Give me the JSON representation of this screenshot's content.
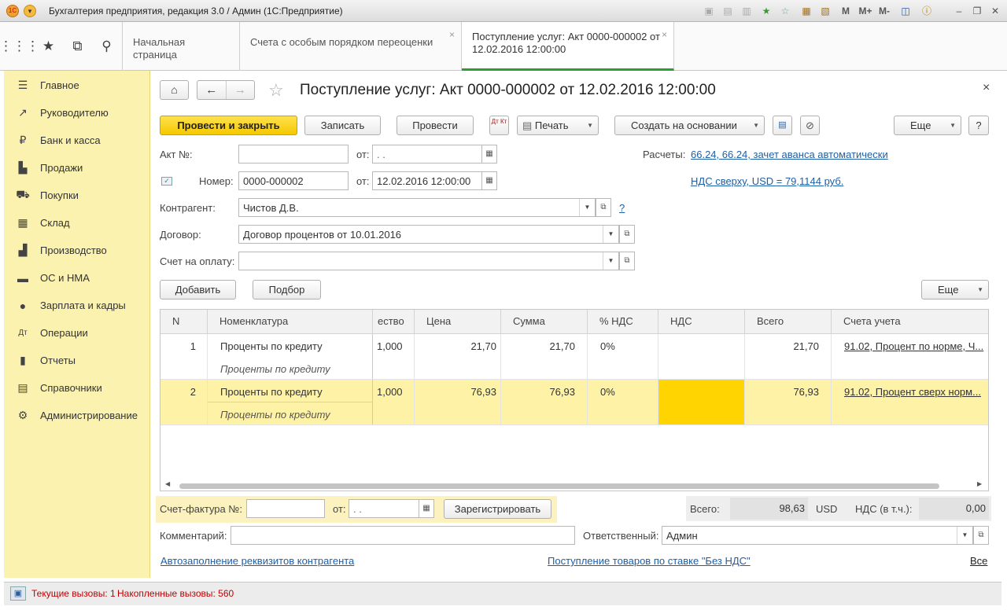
{
  "window": {
    "title": "Бухгалтерия предприятия, редакция 3.0 / Админ  (1С:Предприятие)",
    "tb_m": "M",
    "tb_mplus": "M+",
    "tb_mminus": "M-"
  },
  "tabs": [
    {
      "label": "Начальная страница"
    },
    {
      "label": "Счета с особым порядком переоценки",
      "close": "×"
    },
    {
      "label": "Поступление услуг: Акт 0000-000002 от 12.02.2016 12:00:00",
      "close": "×"
    }
  ],
  "sidebar": {
    "items": [
      {
        "label": "Главное",
        "icon": "menu-icon"
      },
      {
        "label": "Руководителю",
        "icon": "chart-line-icon"
      },
      {
        "label": "Банк и касса",
        "icon": "ruble-icon"
      },
      {
        "label": "Продажи",
        "icon": "bag-icon"
      },
      {
        "label": "Покупки",
        "icon": "cart-icon"
      },
      {
        "label": "Склад",
        "icon": "grid-icon"
      },
      {
        "label": "Производство",
        "icon": "factory-icon"
      },
      {
        "label": "ОС и НМА",
        "icon": "truck-icon"
      },
      {
        "label": "Зарплата и кадры",
        "icon": "person-icon"
      },
      {
        "label": "Операции",
        "icon": "dt-kt-icon"
      },
      {
        "label": "Отчеты",
        "icon": "bar-chart-icon"
      },
      {
        "label": "Справочники",
        "icon": "book-icon"
      },
      {
        "label": "Администрирование",
        "icon": "gear-icon"
      }
    ]
  },
  "form": {
    "title": "Поступление услуг: Акт 0000-000002 от 12.02.2016 12:00:00",
    "close": "×",
    "toolbar": {
      "post_close": "Провести и закрыть",
      "save": "Записать",
      "post": "Провести",
      "print": "Печать",
      "create_based": "Создать на основании",
      "more": "Еще",
      "help": "?",
      "dtkt": "Дт Кт"
    },
    "akt_label": "Акт №:",
    "akt_value": "",
    "from_label": "от:",
    "akt_date": " .  .",
    "number_label": "Номер:",
    "number_value": "0000-000002",
    "number_date": "12.02.2016 12:00:00",
    "raschety_label": "Расчеты:",
    "raschety_link": "66.24, 66.24, зачет аванса автоматически",
    "nds_link": "НДС сверху, USD = 79,1144 руб.",
    "kontragent_label": "Контрагент:",
    "kontragent_value": "Чистов Д.В.",
    "help_q": "?",
    "dogovor_label": "Договор:",
    "dogovor_value": "Договор процентов от 10.01.2016",
    "schet_label": "Счет на оплату:",
    "schet_value": "",
    "add_btn": "Добавить",
    "podbor_btn": "Подбор",
    "more_btn": "Еще"
  },
  "table": {
    "columns": [
      "N",
      "Номенклатура",
      "ество",
      "Цена",
      "Сумма",
      "% НДС",
      "НДС",
      "Всего",
      "Счета учета"
    ],
    "rows": [
      {
        "n": "1",
        "nom": "Проценты по кредиту",
        "nom2": "Проценты по кредиту",
        "qty": "1,000",
        "price": "21,70",
        "sum": "21,70",
        "vat_rate": "0%",
        "vat": "",
        "total": "21,70",
        "account": "91.02, Процент по норме, Ч..."
      },
      {
        "n": "2",
        "nom": "Проценты по кредиту",
        "nom2": "Проценты по кредиту",
        "qty": "1,000",
        "price": "76,93",
        "sum": "76,93",
        "vat_rate": "0%",
        "vat": "",
        "total": "76,93",
        "account": "91.02, Процент сверх норм..."
      }
    ]
  },
  "footer": {
    "invoice_label": "Счет-фактура №:",
    "invoice_value": "",
    "invoice_from": "от:",
    "invoice_date": " .  .",
    "register_btn": "Зарегистрировать",
    "total_label": "Всего:",
    "total_value": "98,63",
    "currency": "USD",
    "vat_label": "НДС (в т.ч.):",
    "vat_value": "0,00",
    "comment_label": "Комментарий:",
    "comment_value": "",
    "responsible_label": "Ответственный:",
    "responsible_value": "Админ",
    "autofill_link": "Автозаполнение реквизитов контрагента",
    "goods_link": "Поступление товаров по ставке \"Без НДС\"",
    "all_link": "Все"
  },
  "status": {
    "current": "Текущие вызовы: 1",
    "accumulated": "Накопленные вызовы: 560"
  },
  "colors": {
    "accent_yellow": "#f5c800",
    "sidebar_bg": "#fbf2b0",
    "link": "#1d5fa7",
    "status_red": "#c00000",
    "tab_active": "#2aa030"
  }
}
